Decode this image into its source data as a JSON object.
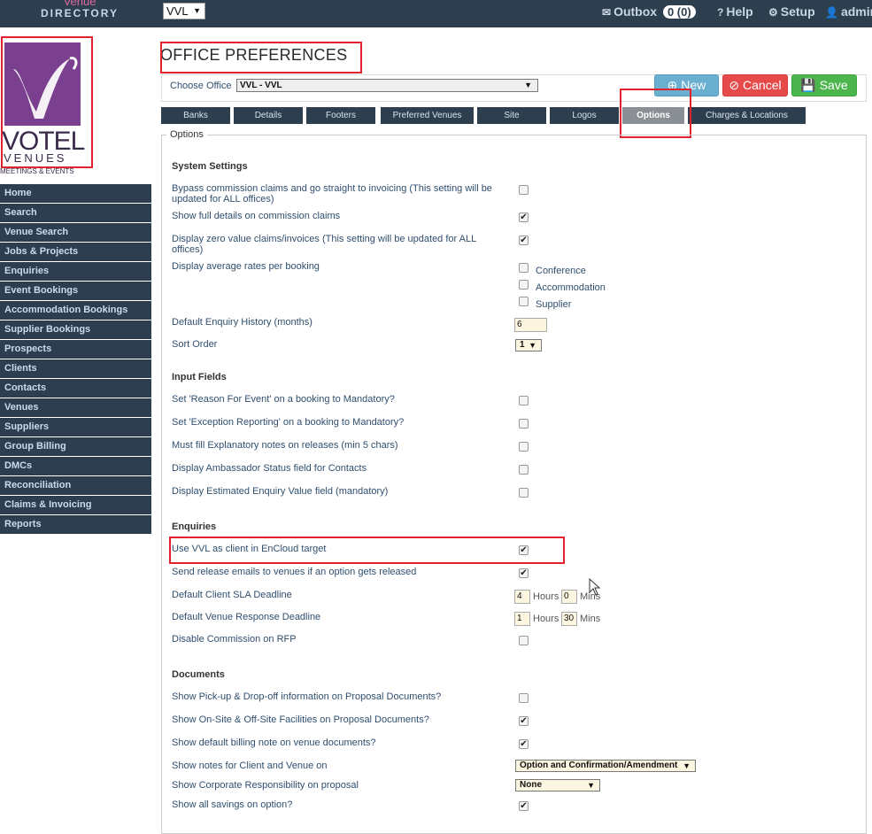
{
  "brand": {
    "line1": "Venue",
    "line2": "DIRECTORY"
  },
  "header": {
    "office_value": "VVL",
    "outbox_label": "Outbox",
    "outbox_count": "0 (0)",
    "help_label": "Help",
    "setup_label": "Setup",
    "admin_label": "admin"
  },
  "logo": {
    "wordmark": "VOTEL",
    "sub": "VENUES",
    "tagline": "MEETINGS & EVENTS"
  },
  "sidebar": {
    "items": [
      {
        "label": "Home"
      },
      {
        "label": "Search"
      },
      {
        "label": "Venue Search"
      },
      {
        "label": "Jobs & Projects"
      },
      {
        "label": "Enquiries"
      },
      {
        "label": "Event Bookings"
      },
      {
        "label": "Accommodation Bookings"
      },
      {
        "label": "Supplier Bookings"
      },
      {
        "label": "Prospects"
      },
      {
        "label": "Clients"
      },
      {
        "label": "Contacts"
      },
      {
        "label": "Venues"
      },
      {
        "label": "Suppliers"
      },
      {
        "label": "Group Billing"
      },
      {
        "label": "DMCs"
      },
      {
        "label": "Reconciliation"
      },
      {
        "label": "Claims & Invoicing"
      },
      {
        "label": "Reports"
      }
    ]
  },
  "page": {
    "title": "OFFICE PREFERENCES",
    "choose_office_label": "Choose Office",
    "choose_office_value": "VVL - VVL"
  },
  "buttons": {
    "new": "New",
    "cancel": "Cancel",
    "save": "Save"
  },
  "tabs": [
    {
      "label": "Banks"
    },
    {
      "label": "Details"
    },
    {
      "label": "Footers"
    },
    {
      "label": "Preferred Venues"
    },
    {
      "label": "Site"
    },
    {
      "label": "Logos"
    },
    {
      "label": "Options",
      "active": true
    },
    {
      "label": "Charges & Locations"
    }
  ],
  "options": {
    "legend": "Options",
    "system_settings": {
      "title": "System Settings",
      "bypass": "Bypass commission claims and go straight to invoicing (This setting will be updated for ALL offices)",
      "full_details": "Show full details on commission claims",
      "zero_value": "Display zero value claims/invoices (This setting will be updated for ALL offices)",
      "avg_rates": "Display average rates per booking",
      "opt_conference": "Conference",
      "opt_accommodation": "Accommodation",
      "opt_supplier": "Supplier",
      "enquiry_history": "Default Enquiry History (months)",
      "enquiry_history_value": "6",
      "sort_order": "Sort Order",
      "sort_order_value": "1"
    },
    "input_fields": {
      "title": "Input Fields",
      "reason": "Set 'Reason For Event' on a booking to Mandatory?",
      "exception": "Set 'Exception Reporting' on a booking to Mandatory?",
      "explanatory": "Must fill Explanatory notes on releases (min 5 chars)",
      "ambassador": "Display Ambassador Status field for Contacts",
      "estimated": "Display Estimated Enquiry Value field (mandatory)"
    },
    "enquiries": {
      "title": "Enquiries",
      "use_vvl": "Use VVL as client in EnCloud target",
      "release_emails": "Send release emails to venues if an option gets released",
      "client_sla": "Default Client SLA Deadline",
      "client_sla_hours": "4",
      "client_sla_mins": "0",
      "venue_response": "Default Venue Response Deadline",
      "venue_response_hours": "1",
      "venue_response_mins": "30",
      "hours_label": "Hours",
      "mins_label": "Mins",
      "disable_commission": "Disable Commission on RFP"
    },
    "documents": {
      "title": "Documents",
      "pickup": "Show Pick-up & Drop-off information on Proposal Documents?",
      "onsite": "Show On-Site & Off-Site Facilities on Proposal Documents?",
      "billing_note": "Show default billing note on venue documents?",
      "notes_client": "Show notes for Client and Venue on",
      "notes_client_value": "Option and Confirmation/Amendment",
      "corporate": "Show Corporate Responsibility on proposal",
      "corporate_value": "None",
      "savings": "Show all savings on option?"
    }
  },
  "checkbox_states": {
    "bypass": false,
    "full_details": true,
    "zero_value": true,
    "conference": false,
    "accommodation": false,
    "supplier": false,
    "reason": false,
    "exception": false,
    "explanatory": false,
    "ambassador": false,
    "estimated": false,
    "use_vvl": true,
    "release_emails": true,
    "disable_commission": false,
    "pickup": false,
    "onsite": true,
    "billing_note": true,
    "savings": true
  },
  "colors": {
    "topbar": "#2d3e4f",
    "sidebar": "#2d3e4f",
    "highlight": "#e0232f",
    "new_button": "#6aaed0",
    "cancel_button": "#e74a4a",
    "save_button": "#4db54d",
    "input_bg": "#fcf5df"
  }
}
